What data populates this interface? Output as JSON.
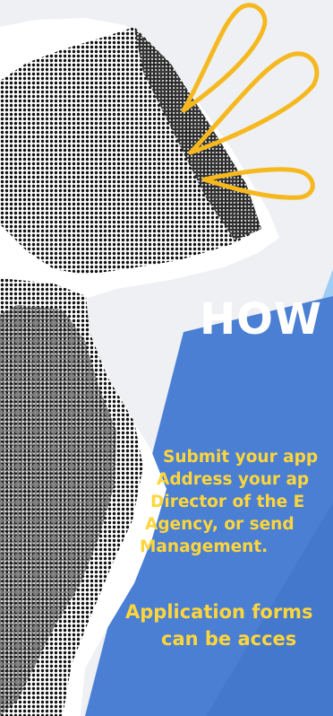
{
  "poster": {
    "heading": "HOW",
    "body_lines": [
      "Submit your app",
      "Address your ap",
      "Director of the E",
      "Agency, or send",
      "Management."
    ],
    "note_lines": [
      "Application forms",
      "can be acces"
    ]
  },
  "colors": {
    "background": "#eef0f4",
    "card_blue": "#4a7fd4",
    "accent_light_blue": "#8fc6f2",
    "text_yellow": "#ffd63a",
    "heading_white": "#ffffff",
    "sound_wave_orange": "#f5b81f"
  },
  "icons": [
    "megaphone-icon",
    "sound-wave-icon"
  ]
}
